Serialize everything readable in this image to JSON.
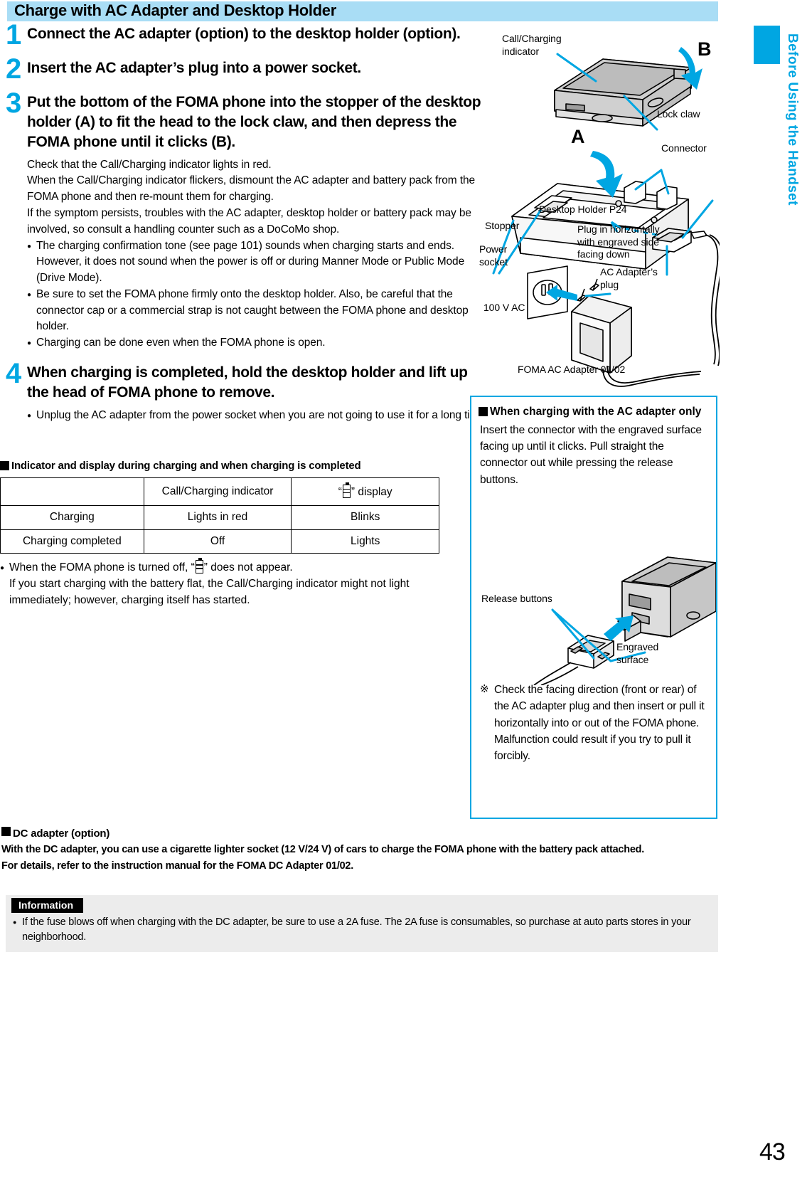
{
  "header": {
    "title": "Charge with AC Adapter and Desktop Holder"
  },
  "sidebar": {
    "vertical_label": "Before Using the Handset",
    "accent_color": "#00a6e2"
  },
  "page_number": "43",
  "steps": [
    {
      "number": "1",
      "heading": "Connect the AC adapter (option) to the desktop holder (option).",
      "body": [],
      "bullets": []
    },
    {
      "number": "2",
      "heading": "Insert the AC adapter’s plug into a power socket.",
      "body": [],
      "bullets": []
    },
    {
      "number": "3",
      "heading": "Put the bottom of the FOMA phone into the stopper of the desktop holder (A) to fit the head to the lock claw, and then depress the FOMA phone until it clicks (B).",
      "body": [
        "Check that the Call/Charging indicator lights in red.",
        "When the Call/Charging indicator flickers, dismount the AC adapter and battery pack from the FOMA phone and then re-mount them for charging.",
        "If the symptom persists, troubles with the AC adapter, desktop holder or battery pack may be involved, so consult a handling counter such as a DoCoMo shop."
      ],
      "bullets": [
        "The charging confirmation tone (see page 101) sounds when charging starts and ends. However, it does not sound when the power is off or during Manner Mode or Public Mode (Drive Mode).",
        "Be sure to set the FOMA phone firmly onto the desktop holder. Also, be careful that the connector cap or a commercial strap is not caught between the FOMA phone and desktop holder.",
        "Charging can be done even when the FOMA phone is open."
      ]
    },
    {
      "number": "4",
      "heading": "When charging is completed, hold the desktop holder and lift up the head of FOMA phone to remove.",
      "body": [],
      "bullets": [
        "Unplug the AC adapter from the power socket when you are not going to use it for a long time."
      ]
    }
  ],
  "indicator_section": {
    "heading": "Indicator and display during charging and when charging is completed",
    "table": {
      "headers": [
        "",
        "Call/Charging indicator",
        "“ ” display"
      ],
      "header_display_prefix": "“",
      "header_display_suffix": "” display",
      "rows": [
        {
          "label": "Charging",
          "indicator": "Lights in red",
          "display": "Blinks"
        },
        {
          "label": "Charging completed",
          "indicator": "Off",
          "display": "Lights"
        }
      ]
    },
    "note_bullet_prefix": "When the FOMA phone is turned off, “",
    "note_bullet_suffix": "” does not appear.",
    "note_lines": [
      "If you start charging with the battery flat, the Call/Charging indicator might not light",
      "immediately; however, charging itself has started."
    ]
  },
  "dc_section": {
    "heading": "DC adapter (option)",
    "lines": [
      "With the DC adapter, you can use a cigarette lighter socket (12 V/24 V) of cars to charge the FOMA phone with the battery pack attached.",
      "For details, refer to the instruction manual for the FOMA DC Adapter 01/02."
    ]
  },
  "information": {
    "label": "Information",
    "text": "If the fuse blows off when charging with the DC adapter, be sure to use a 2A fuse. The 2A fuse is consumables, so purchase at auto parts stores in your neighborhood."
  },
  "figure": {
    "labels": {
      "call_charging_indicator": "Call/Charging\nindicator",
      "letter_b": "B",
      "letter_a": "A",
      "lock_claw": "Lock claw",
      "connector": "Connector",
      "stopper": "Stopper",
      "desktop_holder": "Desktop Holder P24",
      "plug_in_horizontally": "Plug in horizontally\nwith engraved side\nfacing down",
      "power_socket": "Power\nsocket",
      "voltage": "100 V AC",
      "ac_adapter_plug": "AC Adapter’s\nplug",
      "foma_ac_adapter": "FOMA AC Adapter 01/02"
    }
  },
  "note_box": {
    "heading": "When charging with the AC adapter only",
    "body": "Insert the connector with the engraved surface facing up until it clicks. Pull straight the connector out while pressing the release buttons.",
    "figure_labels": {
      "release_buttons": "Release buttons",
      "engraved_surface": "Engraved\nsurface"
    },
    "footnote_mark": "※",
    "footnote": "Check the facing direction (front or rear) of the AC adapter plug and then insert or pull it horizontally into or out of the FOMA phone.\nMalfunction could result if you try to pull it forcibly."
  }
}
